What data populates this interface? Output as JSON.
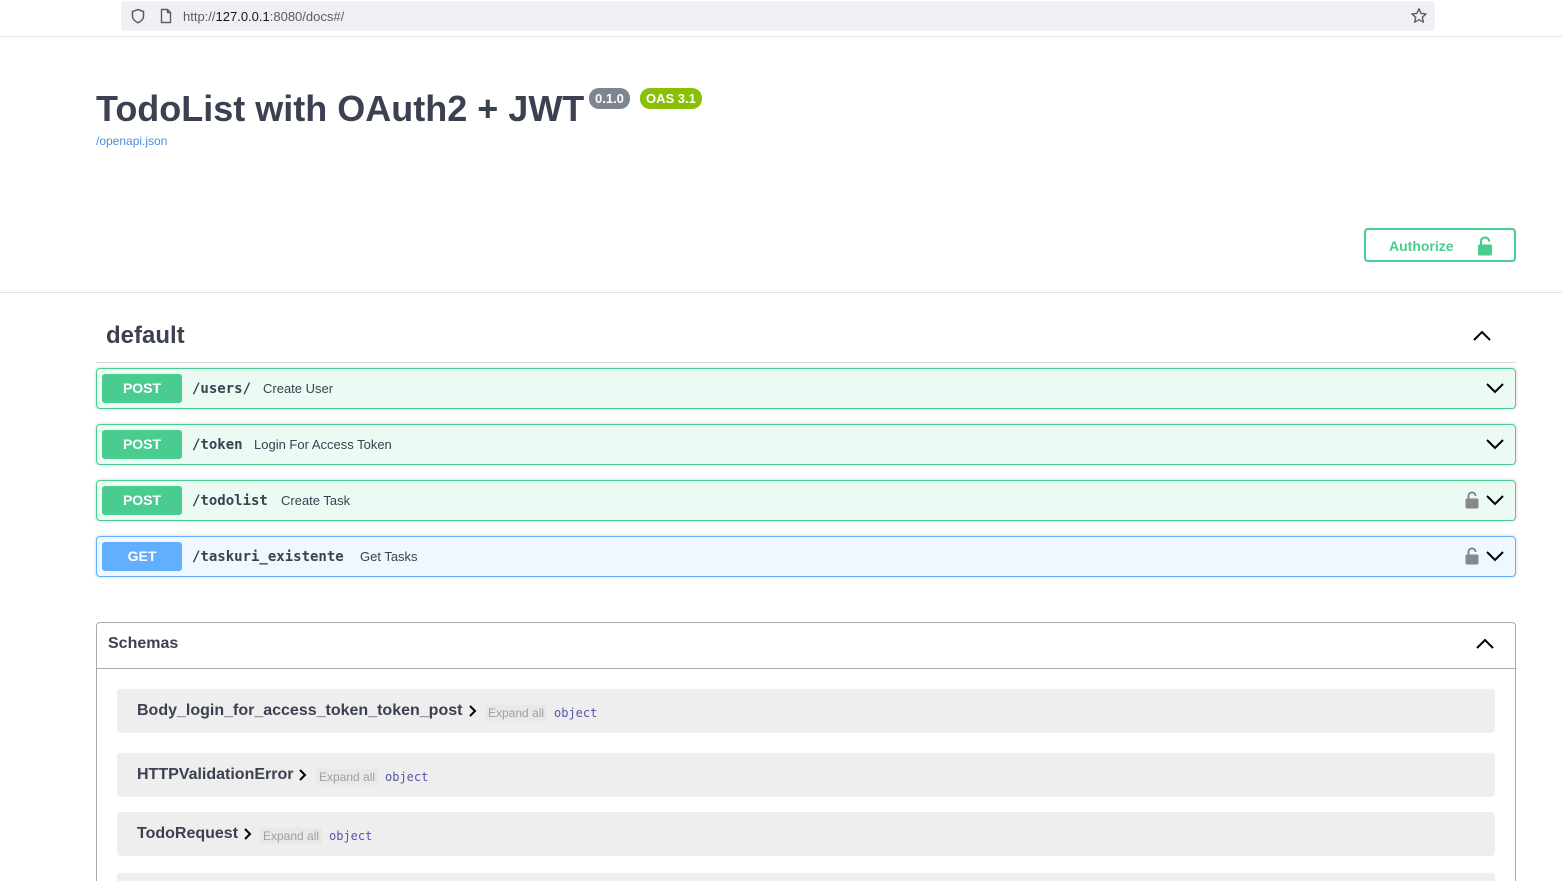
{
  "browser": {
    "url_prefix": "http://",
    "url_host": "127.0.0.1",
    "url_rest": ":8080/docs#/"
  },
  "info": {
    "title": "TodoList with OAuth2 + JWT",
    "version": "0.1.0",
    "oas_version": "OAS 3.1",
    "spec_link": "/openapi.json"
  },
  "auth": {
    "label": "Authorize"
  },
  "tag": {
    "name": "default"
  },
  "operations": [
    {
      "method": "POST",
      "path": "/users/",
      "summary": "Create User",
      "locked": false
    },
    {
      "method": "POST",
      "path": "/token",
      "summary": "Login For Access Token",
      "locked": false
    },
    {
      "method": "POST",
      "path": "/todolist",
      "summary": "Create Task",
      "locked": true
    },
    {
      "method": "GET",
      "path": "/taskuri_existente",
      "summary": "Get Tasks",
      "locked": true
    }
  ],
  "schemas": {
    "title": "Schemas",
    "expand_all_label": "Expand all",
    "items": [
      {
        "name": "Body_login_for_access_token_token_post",
        "type": "object"
      },
      {
        "name": "HTTPValidationError",
        "type": "object"
      },
      {
        "name": "TodoRequest",
        "type": "object"
      }
    ]
  },
  "colors": {
    "post": "#49cc90",
    "get": "#61affe",
    "version_badge": "#7d8492",
    "oas_badge": "#89bf04",
    "link": "#4990e2"
  }
}
